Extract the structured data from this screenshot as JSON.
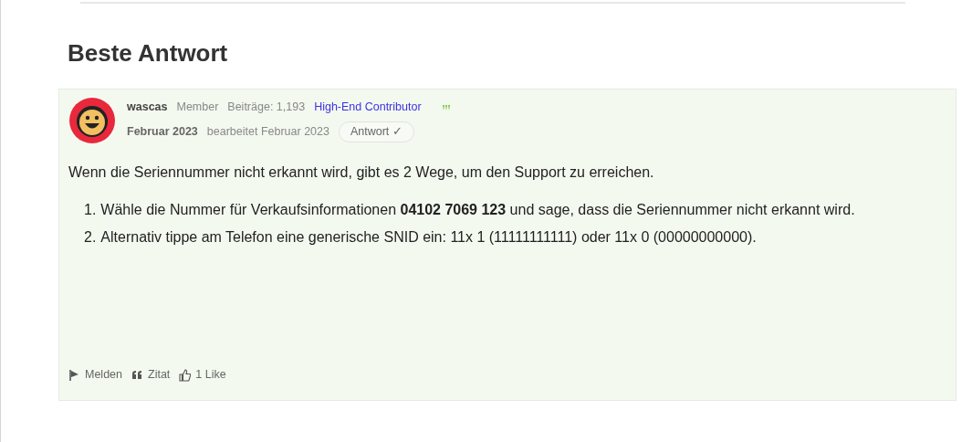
{
  "heading": "Beste Antwort",
  "post": {
    "author": "wascas",
    "role": "Member",
    "posts": "Beiträge: 1,193",
    "rank": "High-End Contributor",
    "date": "Februar 2023",
    "edited": "bearbeitet Februar 2023",
    "answer_badge": "Antwort ✓",
    "intro": "Wenn die Seriennummer nicht erkannt wird, gibt es 2 Wege, um den Support zu erreichen.",
    "steps": [
      {
        "marker": "1.",
        "text": "Wähle die Nummer für Verkaufsinformationen **04102 7069 123** und sage, dass die Seriennummer nicht erkannt wird."
      },
      {
        "marker": "2.",
        "text": "Alternativ tippe am Telefon eine generische SNID ein: 11x 1 (11111111111) oder 11x 0 (00000000000)."
      }
    ],
    "actions": [
      {
        "kind": "report",
        "label": "Melden"
      },
      {
        "kind": "quote",
        "label": "Zitat"
      },
      {
        "kind": "like",
        "label": "1 Like"
      }
    ]
  }
}
